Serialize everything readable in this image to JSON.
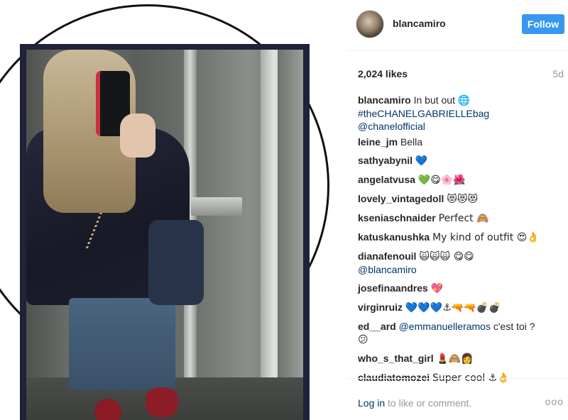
{
  "post": {
    "username": "blancamiro",
    "follow_label": "Follow",
    "likes": "2,024 likes",
    "time_ago": "5d"
  },
  "caption": {
    "user": "blancamiro",
    "text": "In but out",
    "emoji": "🌐",
    "hashtag": "#theCHANELGABRIELLEbag",
    "mention": "@chanelofficial"
  },
  "comments": [
    {
      "user": "leine_jm",
      "text": "Bella"
    },
    {
      "user": "sathyabynil",
      "text": "💙"
    },
    {
      "user": "angelatvusa",
      "text": "💚😋🌸🌺"
    },
    {
      "user": "lovely_vintagedoll",
      "text": "😻😻😻"
    },
    {
      "user": "kseniaschnaider",
      "text": "Perfect 🙈"
    },
    {
      "user": "katuskanushka",
      "text": "My kind of outfit 😍👌"
    },
    {
      "user": "dianafenouil",
      "text": "🙀🙀🙀 😋😋",
      "mention": "@blancamiro"
    },
    {
      "user": "josefinaandres",
      "text": "💖"
    },
    {
      "user": "virginruiz",
      "text": "💙💙💙⚓🔫🔫💣💣"
    },
    {
      "user": "ed__ard",
      "text": "c'est toi ?",
      "mention": "@emmanuelleramos",
      "extra": "😕"
    },
    {
      "user": "who_s_that_girl",
      "text": "💄🙈👩"
    },
    {
      "user": "claudiatomozei",
      "text": "Super cool ⚓👌"
    }
  ],
  "footer": {
    "login_link": "Log in",
    "login_text": " to like or comment.",
    "more": "ooo"
  }
}
